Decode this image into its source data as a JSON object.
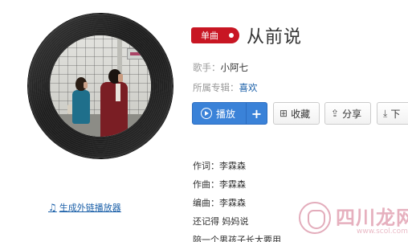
{
  "song": {
    "badge": "单曲",
    "title": "从前说"
  },
  "meta": {
    "artist_label": "歌手：",
    "artist": "小阿七",
    "album_label": "所属专辑：",
    "album": "喜欢"
  },
  "actions": {
    "play": "播放",
    "add": "+",
    "collect": "收藏",
    "share": "分享",
    "download": "下"
  },
  "credits": {
    "lyricist": "作词：李霖森",
    "composer": "作曲：李霖森",
    "arranger": "编曲：李霖森",
    "line1": "还记得 妈妈说",
    "line2": "陪一个男孩子长大要用"
  },
  "player_link": "生成外链播放器",
  "watermark": {
    "text": "四川龙网",
    "sub": "www.scol.com.cn"
  },
  "colors": {
    "badge": "#c81623",
    "primary": "#3a82d8",
    "link": "#1a5fa8"
  }
}
